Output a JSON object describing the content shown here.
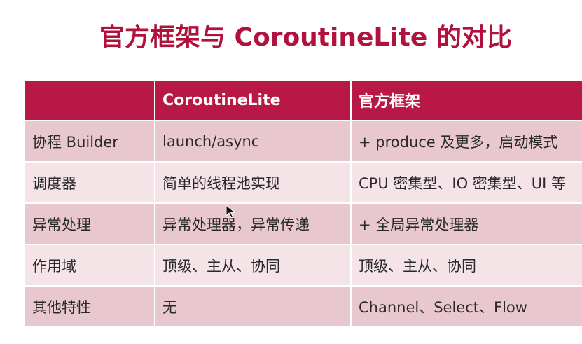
{
  "title": "官方框架与 CoroutineLite 的对比",
  "table": {
    "headers": [
      "",
      "CoroutineLite",
      "官方框架"
    ],
    "rows": [
      [
        "协程 Builder",
        "launch/async",
        "+ produce 及更多，启动模式"
      ],
      [
        "调度器",
        "简单的线程池实现",
        "CPU 密集型、IO 密集型、UI 等"
      ],
      [
        "异常处理",
        "异常处理器，异常传递",
        "+ 全局异常处理器"
      ],
      [
        "作用域",
        "顶级、主从、协同",
        "顶级、主从、协同"
      ],
      [
        "其他特性",
        "无",
        "Channel、Select、Flow"
      ]
    ]
  },
  "colors": {
    "title": "#b0123e",
    "header_bg": "#b81846",
    "row_odd": "#e8c7cf",
    "row_even": "#f4e3e7"
  },
  "icons": {
    "cursor": "mouse-pointer-icon"
  }
}
